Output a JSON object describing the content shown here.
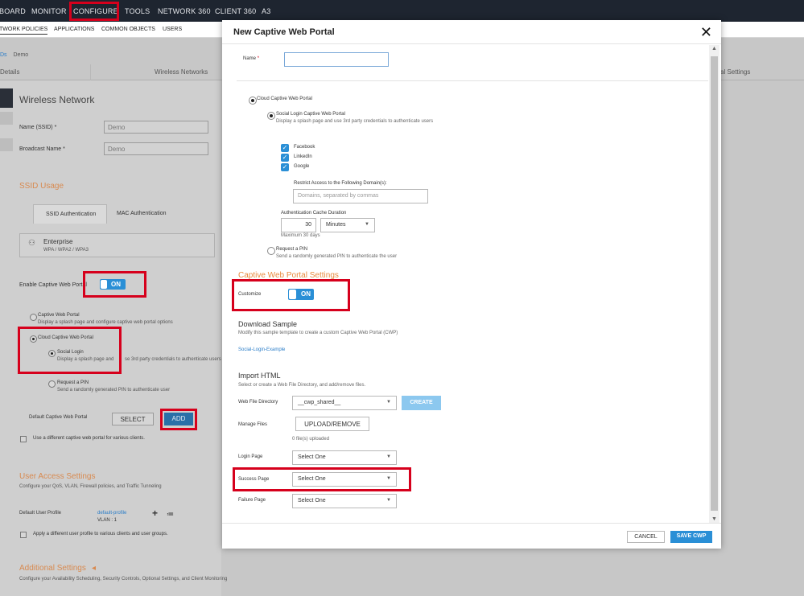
{
  "topnav": {
    "items": [
      "BOARD",
      "MONITOR",
      "CONFIGURE",
      "TOOLS",
      "NETWORK 360",
      "CLIENT 360",
      "A3"
    ]
  },
  "subnav": {
    "items": [
      "TWORK POLICIES",
      "APPLICATIONS",
      "COMMON OBJECTS",
      "USERS"
    ]
  },
  "background": {
    "breadcrumb_link": "Ds",
    "breadcrumb_current": "Demo",
    "tabs": [
      "Details",
      "Wireless Networks",
      "al Settings"
    ],
    "title": "Wireless Network",
    "ssid_label": "Name (SSID)",
    "ssid_value": "Demo",
    "broadcast_label": "Broadcast Name",
    "broadcast_value": "Demo",
    "ssid_usage": "SSID Usage",
    "auth_tabs": [
      "SSID Authentication",
      "MAC Authentication"
    ],
    "enterprise_title": "Enterprise",
    "enterprise_sub": "WPA / WPA2 / WPA3",
    "enable_cwp_label": "Enable Captive Web Portal",
    "toggle_text": "ON",
    "cwp_title": "Captive Web Portal",
    "cwp_desc": "Display a splash page and configure captive web portal options",
    "cloud_cwp_title": "Cloud Captive Web Portal",
    "social_title": "Social Login",
    "social_desc_a": "Display a splash page and",
    "social_desc_b": "se 3rd party credentials to authenticate users",
    "pin_title": "Request a PIN",
    "pin_desc": "Send a randomly generated PIN to authenticate user",
    "default_cwp_label": "Default Captive Web Portal",
    "select_label": "SELECT",
    "add_label": "ADD",
    "diff_cwp_label": "Use a different captive web portal for various clients.",
    "user_access_title": "User Access Settings",
    "user_access_desc": "Configure your QoS, VLAN, Firewall policies, and Traffic Tunneling",
    "default_profile_label": "Default User Profile",
    "default_profile_link": "default-profile",
    "vlan": "VLAN : 1",
    "plus": "+",
    "diff_profile_label": "Apply a different user profile to various clients and user groups.",
    "additional_title": "Additional Settings",
    "additional_arrow": "◂",
    "additional_desc": "Configure your Availability Scheduling, Security Controls, Optional Settings, and Client Monitoring"
  },
  "modal": {
    "title": "New Captive Web Portal",
    "close": "✕",
    "name_label": "Name",
    "required_mark": "*",
    "name_value": "",
    "cloud_cwp": "Cloud Captive Web Portal",
    "social_title": "Social Login Captive Web Portal",
    "social_desc": "Display a splash page and use 3rd party credentials to authenticate users",
    "providers": [
      "Facebook",
      "LinkedIn",
      "Google"
    ],
    "restrict_label": "Restrict Access to the Following Domain(s):",
    "domains_placeholder": "Domains, separated by commas",
    "cache_label": "Authentication Cache Duration",
    "cache_value": "30",
    "cache_unit": "Minutes",
    "cache_max": "Maximum 30 days",
    "pin_title": "Request a PIN",
    "pin_desc": "Send a randomly generated PIN to authenticate the user",
    "settings_title": "Captive Web Portal Settings",
    "customize_label": "Customize",
    "toggle_text": "ON",
    "download_title": "Download Sample",
    "download_desc": "Modify this sample template to create a custom Captive Web Portal (CWP)",
    "download_link": "Social-Login-Example",
    "import_title": "Import HTML",
    "import_desc": "Select or create a Web File Directory, and add/remove files.",
    "web_dir_label": "Web File Directory",
    "web_dir_value": "__cwp_shared__",
    "create_label": "CREATE",
    "manage_label": "Manage Files",
    "upload_label": "UPLOAD/REMOVE",
    "uploaded_count": "0 file(s) uploaded",
    "login_label": "Login Page",
    "success_label": "Success Page",
    "failure_label": "Failure Page",
    "select_one": "Select One",
    "cancel_label": "CANCEL",
    "save_label": "SAVE CWP"
  },
  "colors": {
    "accent": "#2a8fd6",
    "highlight": "#d6001c",
    "orange": "#e8893c"
  }
}
